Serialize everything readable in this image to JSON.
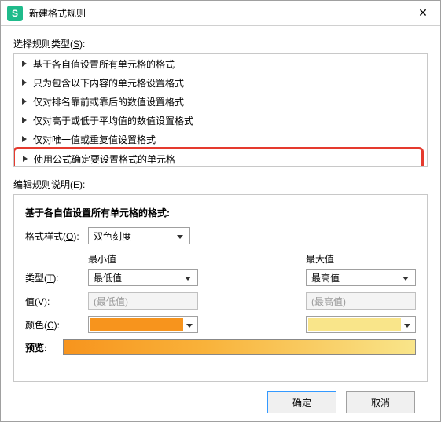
{
  "titlebar": {
    "app_icon_letter": "S",
    "title": "新建格式规则"
  },
  "select_rule_type": {
    "label_prefix": "选择规则类型(",
    "label_u": "S",
    "label_suffix": "):",
    "items": [
      "基于各自值设置所有单元格的格式",
      "只为包含以下内容的单元格设置格式",
      "仅对排名靠前或靠后的数值设置格式",
      "仅对高于或低于平均值的数值设置格式",
      "仅对唯一值或重复值设置格式",
      "使用公式确定要设置格式的单元格"
    ]
  },
  "edit_desc": {
    "label_prefix": "编辑规则说明(",
    "label_u": "E",
    "label_suffix": "):",
    "heading": "基于各自值设置所有单元格的格式:",
    "style_label_prefix": "格式样式(",
    "style_label_u": "O",
    "style_label_suffix": "):",
    "style_value": "双色刻度",
    "min_header": "最小值",
    "max_header": "最大值",
    "type_label_prefix": "类型(",
    "type_label_u": "T",
    "type_label_suffix": "):",
    "type_min": "最低值",
    "type_max": "最高值",
    "value_label_prefix": "值(",
    "value_label_u": "V",
    "value_label_suffix": "):",
    "value_min_placeholder": "(最低值)",
    "value_max_placeholder": "(最高值)",
    "color_label_prefix": "颜色(",
    "color_label_u": "C",
    "color_label_suffix": "):",
    "color_min": "#f7941d",
    "color_max": "#f9e58a",
    "preview_label": "预览:"
  },
  "buttons": {
    "ok": "确定",
    "cancel": "取消"
  }
}
